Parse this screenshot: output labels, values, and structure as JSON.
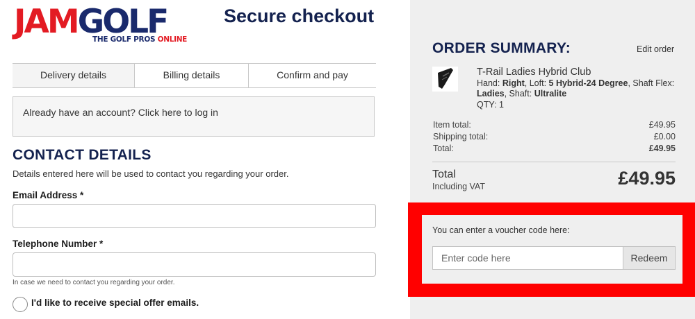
{
  "logo": {
    "jam": "JAM",
    "golf": "GOLF",
    "tagline_1": "THE GOLF PROS ",
    "tagline_2": "ONLINE"
  },
  "page_title": "Secure checkout",
  "tabs": [
    {
      "label": "Delivery details"
    },
    {
      "label": "Billing details"
    },
    {
      "label": "Confirm and pay"
    }
  ],
  "account": {
    "text": "Already have an account? Click here to log in"
  },
  "contact": {
    "heading": "CONTACT DETAILS",
    "subtext": "Details entered here will be used to contact you regarding your order.",
    "email_label": "Email Address *",
    "phone_label": "Telephone Number *",
    "phone_hint": "In case we need to contact you regarding your order.",
    "offers_label": "I'd like to receive special offer emails."
  },
  "summary": {
    "title": "ORDER SUMMARY:",
    "edit_label": "Edit order",
    "product": {
      "name": "T-Rail Ladies Hybrid Club",
      "hand_label": "Hand: ",
      "hand": "Right",
      "loft_label": ", Loft: ",
      "loft": "5 Hybrid-24 Degree",
      "flex_label": ", Shaft Flex: ",
      "flex": "Ladies",
      "shaft_label": ", Shaft: ",
      "shaft": "Ultralite",
      "qty": "QTY: 1"
    },
    "item_total_label": "Item total:",
    "item_total": "£49.95",
    "shipping_label": "Shipping total:",
    "shipping": "£0.00",
    "total_label": "Total:",
    "total": "£49.95",
    "grand_total_label": "Total",
    "vat_label": "Including VAT",
    "grand_total": "£49.95"
  },
  "voucher": {
    "text": "You can enter a voucher code here:",
    "placeholder": "Enter code here",
    "button": "Redeem"
  },
  "colors": {
    "brand_navy": "#14224f",
    "brand_red": "#e31b23",
    "highlight": "#ff0000"
  },
  "icons": {
    "product": "golf-club-icon"
  }
}
